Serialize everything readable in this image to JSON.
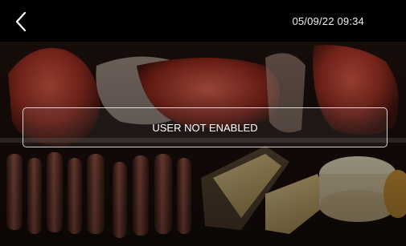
{
  "header": {
    "back_icon": "chevron-left-icon",
    "datetime": "05/09/22 09:34"
  },
  "message": {
    "text": "USER NOT ENABLED"
  },
  "background": {
    "description_icon": "deli-products-photo"
  }
}
